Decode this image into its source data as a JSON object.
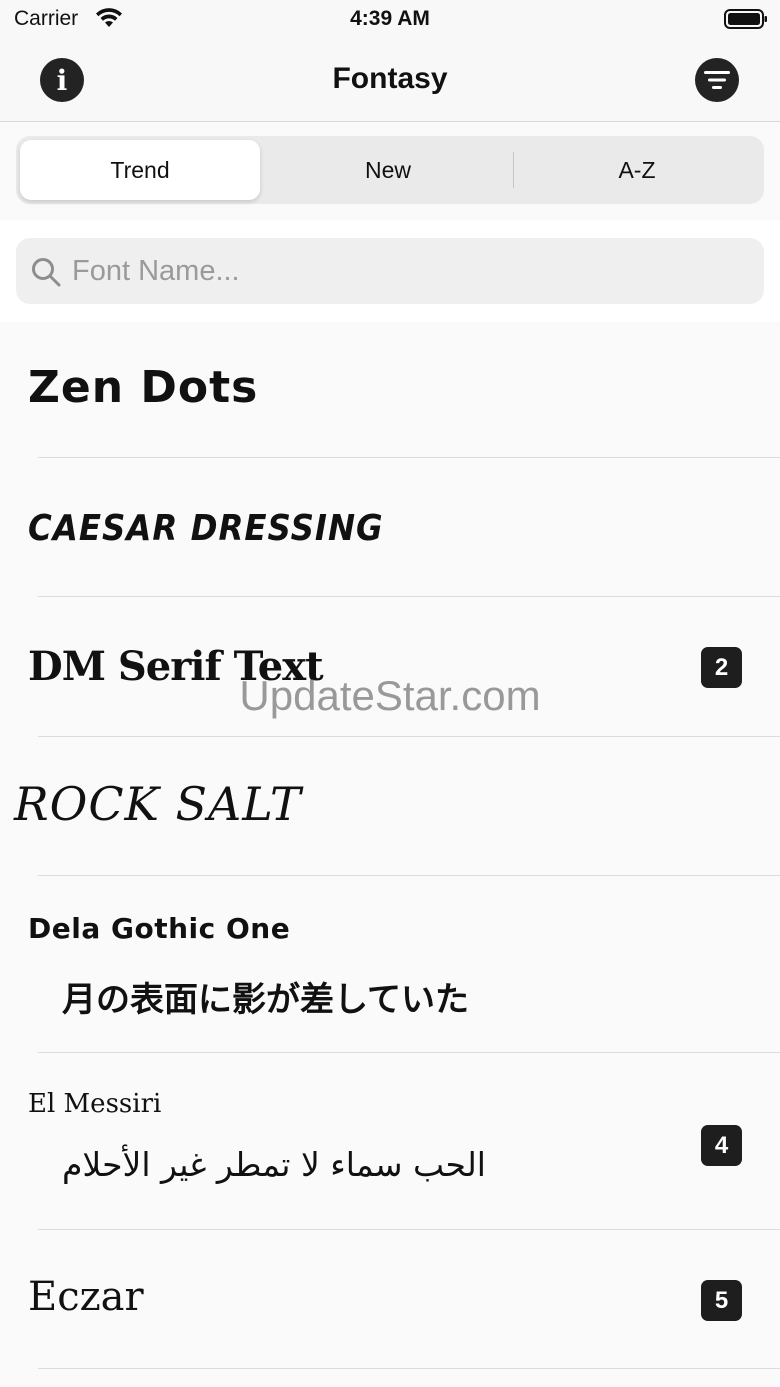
{
  "status_bar": {
    "carrier": "Carrier",
    "time": "4:39 AM"
  },
  "nav": {
    "title": "Fontasy",
    "info_icon": "info-icon",
    "filter_icon": "filter-icon"
  },
  "segments": [
    "Trend",
    "New",
    "A-Z"
  ],
  "selected_segment": "Trend",
  "search": {
    "placeholder": "Font Name...",
    "value": ""
  },
  "fonts": [
    {
      "name": "Zen Dots"
    },
    {
      "name": "CAESAR DRESSING"
    },
    {
      "name": "DM Serif Text",
      "badge": "2"
    },
    {
      "name": "ROCK SALT"
    },
    {
      "name": "Dela Gothic One",
      "sample": "月の表面に影が差していた"
    },
    {
      "name": "El Messiri",
      "sample": "الحب سماء لا تمطر غير الأحلام",
      "badge": "4"
    },
    {
      "name": "Eczar",
      "badge": "5"
    }
  ],
  "watermark": "UpdateStar.com",
  "colors": {
    "background": "#fafafa",
    "badge": "#1e1e1e",
    "segment_bg": "#eaeaea",
    "search_bg": "#efefef"
  }
}
